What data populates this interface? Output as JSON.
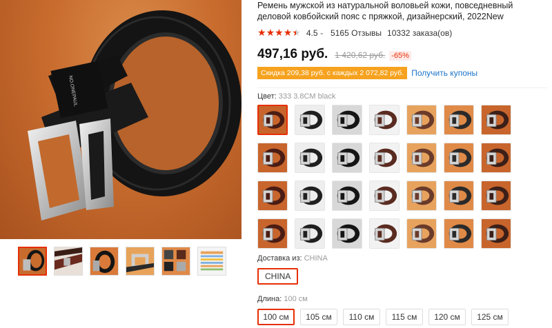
{
  "product": {
    "title": "Ремень мужской из натуральной воловьей кожи, повседневный деловой ковбойский пояс с пряжкой, дизайнерский, 2022New",
    "rating": "4.5",
    "reviews": "5165 Отзывы",
    "orders": "10332 заказа(ов)",
    "price": "497,16 руб.",
    "old_price": "1 420,62 руб.",
    "discount": "-65%",
    "coupon_text": "Скидка 209,38 руб. с каждых 2 072,82 руб.",
    "coupon_link": "Получить купоны",
    "brand_mark": "NO.ONEPAUL"
  },
  "icons": {
    "star": "star-icon",
    "half_star": "half-star-icon",
    "chevron": "chevron-down-icon"
  },
  "colors": {
    "accent": "#e62e04",
    "coupon": "#f6a21e",
    "link": "#1a73c9",
    "backdrop": "#c86c2e"
  },
  "gallery": {
    "thumb_count": 6,
    "active_index": 0
  },
  "color_option": {
    "label": "Цвет:",
    "value": "333 3.8CM black",
    "swatch_count": 28,
    "selected_index": 0
  },
  "shipping": {
    "label": "Доставка из:",
    "value": "CHINA",
    "option": "CHINA"
  },
  "length": {
    "label": "Длина:",
    "value": "100 см",
    "options": [
      "100 см",
      "105 см",
      "110 см",
      "115 см",
      "120 см",
      "125 см"
    ],
    "selected_index": 0
  }
}
